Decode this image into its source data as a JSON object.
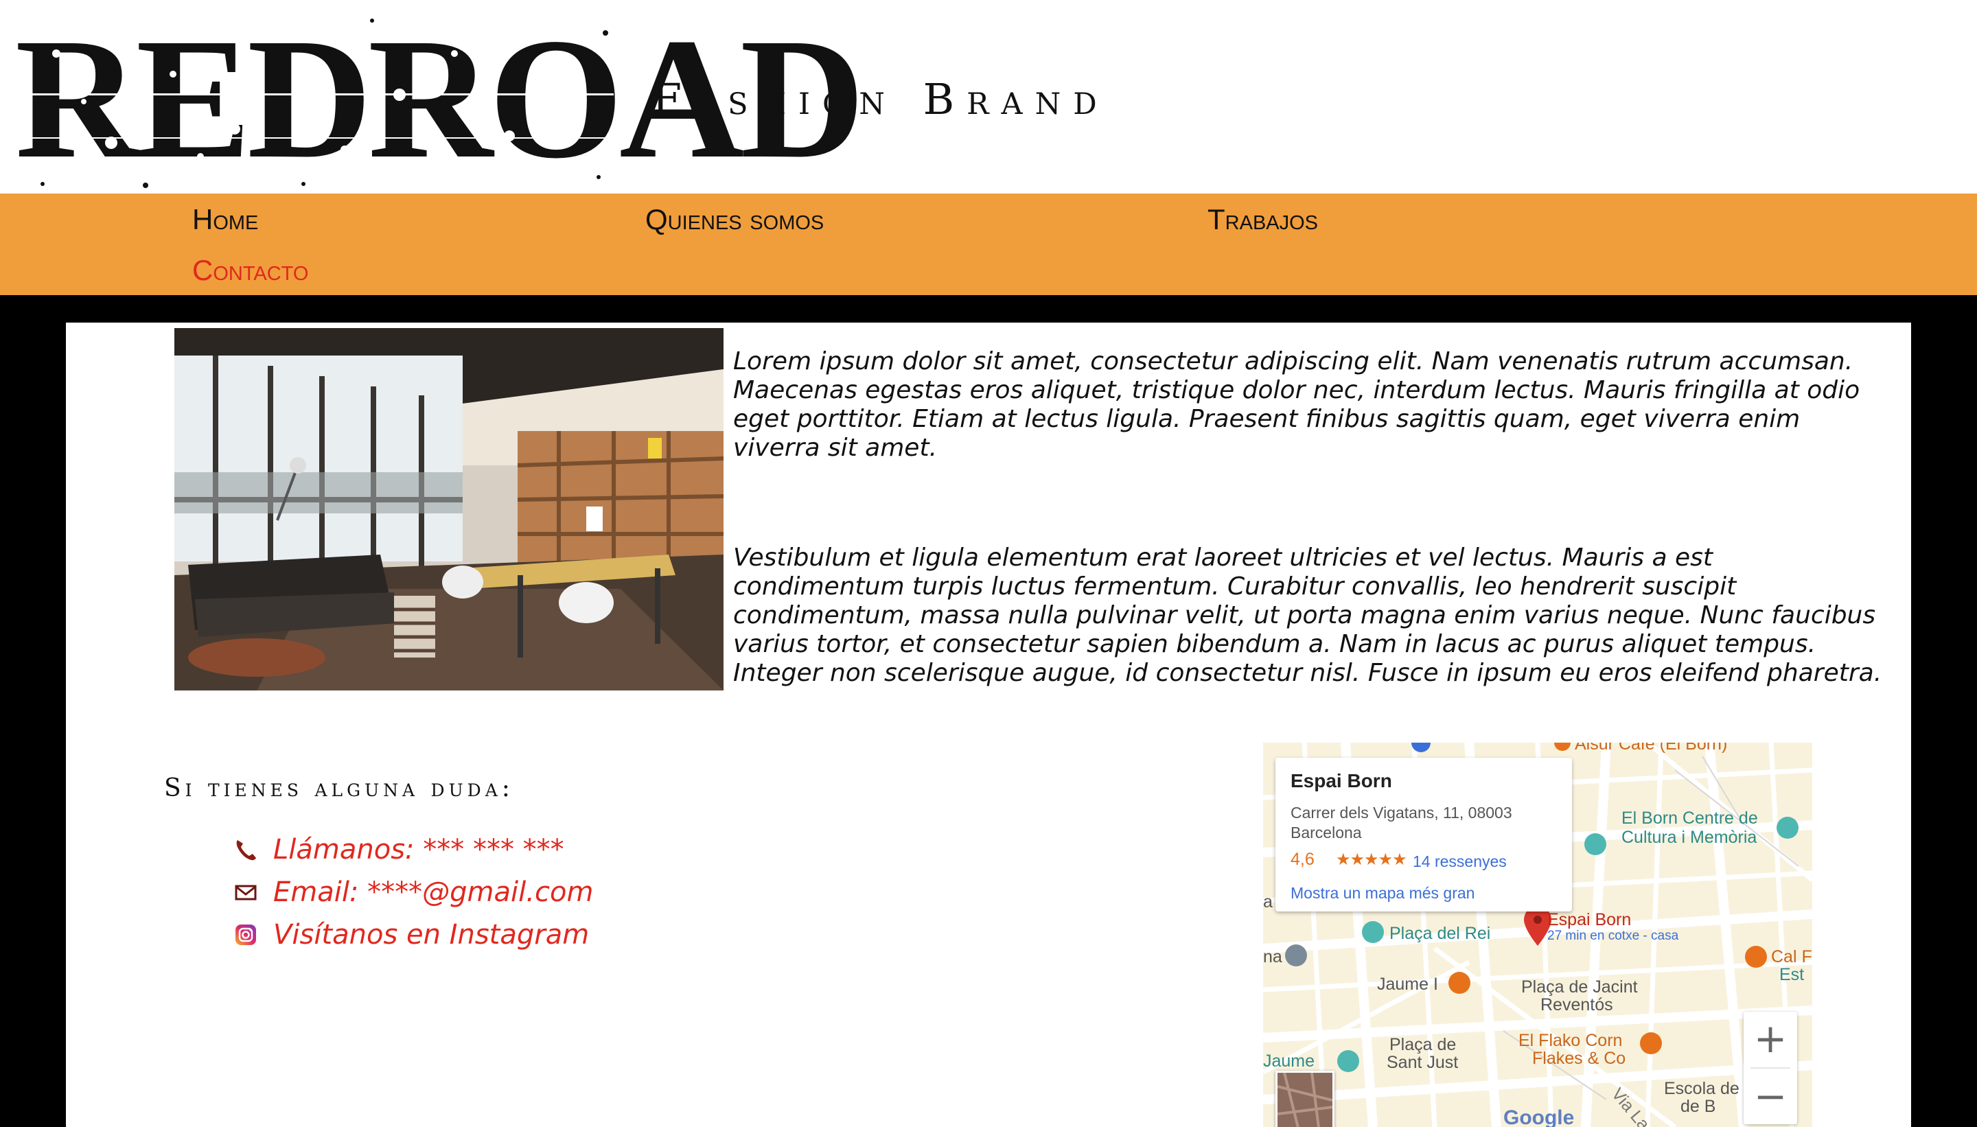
{
  "brand": {
    "logo_text": "REDROAD",
    "tagline": "Fashion Brand"
  },
  "nav": {
    "items": [
      {
        "label": "Home"
      },
      {
        "label": "Quienes somos"
      },
      {
        "label": "Trabajos"
      },
      {
        "label": "Contacto",
        "active": true
      }
    ]
  },
  "main": {
    "paragraph_1": "Lorem ipsum dolor sit amet, consectetur adipiscing elit. Nam venenatis rutrum accumsan. Maecenas egestas eros aliquet, tristique dolor nec, interdum lectus. Mauris fringilla at odio eget porttitor. Etiam at lectus ligula. Praesent finibus sagittis quam, eget viverra enim viverra sit amet.",
    "paragraph_2": "Vestibulum et ligula elementum erat laoreet ultricies et vel lectus. Mauris a est condimentum turpis luctus fermentum. Curabitur convallis, leo hendrerit suscipit condimentum, massa nulla pulvinar velit, ut porta magna enim varius neque. Nunc faucibus varius tortor, et consectetur sapien bibendum a. Nam in lacus ac purus aliquet tempus. Integer non scelerisque augue, id consectetur nisl. Fusce in ipsum eu eros eleifend pharetra."
  },
  "contact": {
    "heading": "Si tienes alguna duda:",
    "phone": "Llámanos: *** *** ***",
    "email": "Email: ****@gmail.com",
    "instagram": "Visítanos en Instagram"
  },
  "map": {
    "place_name": "Espai Born",
    "address": "Carrer dels Vigatans, 11, 08003 Barcelona",
    "rating": "4,6",
    "stars": "★★★★★",
    "reviews": "14 ressenyes",
    "bigger_map": "Mostra un mapa més gran",
    "marker_label": "Espai Born",
    "marker_sublabel": "27 min en cotxe - casa",
    "labels": {
      "born_centre": "El Born Centre de",
      "born_centre_2": "Cultura i Memòria",
      "placa_rei": "Plaça del Rei",
      "jaume": "Jaume I",
      "jacint": "Plaça de Jacint",
      "jacint_2": "Reventós",
      "flako": "El Flako Corn",
      "flako_2": "Flakes & Co",
      "sant_just": "Plaça de",
      "sant_just_2": "Sant Just",
      "escola": "Escola de",
      "cal": "Cal F",
      "est": "Est",
      "cafe": "Aisur Cafe (El Born)",
      "via": "Via La",
      "edge_a": "a",
      "edge_na": "na",
      "edge_jaume": "Jaume",
      "edge_b": "de B"
    },
    "zoom_in": "+",
    "zoom_out": "−",
    "google": "Google"
  },
  "colors": {
    "nav_bg": "#f09d3b",
    "accent_red": "#e0281e",
    "link_blue": "#3a6fd8",
    "rating_orange": "#e7711b"
  }
}
